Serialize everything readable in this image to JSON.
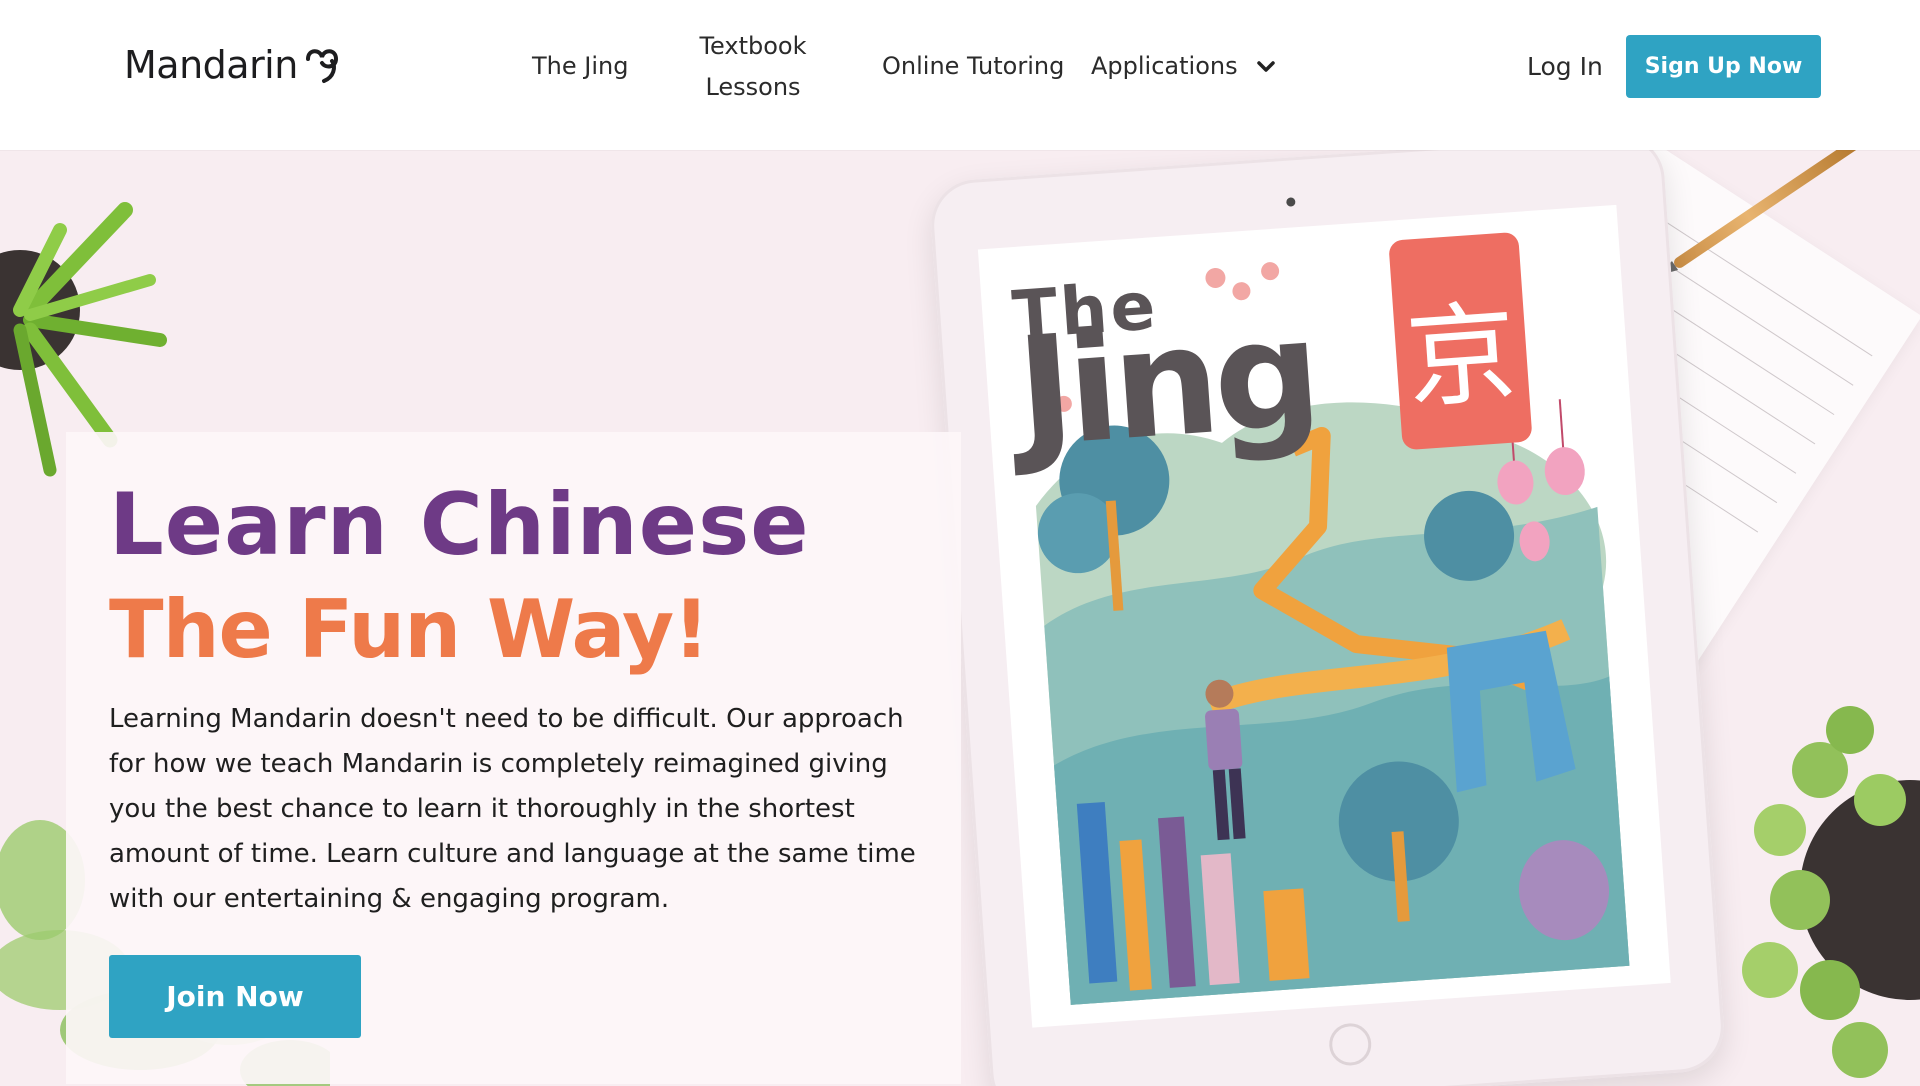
{
  "header": {
    "logo_text": "Mandarin",
    "nav": {
      "the_jing": "The Jing",
      "textbook_line1": "Textbook",
      "textbook_line2": "Lessons",
      "online_tutoring": "Online Tutoring",
      "applications": "Applications"
    },
    "login_label": "Log In",
    "signup_label": "Sign Up Now"
  },
  "hero": {
    "headline": "Learn Chinese",
    "subheadline": "The Fun Way!",
    "description": "Learning Mandarin doesn't need to be difficult. Our approach for how we teach Mandarin is completely reimagined giving you the best chance to learn it thoroughly in the shortest amount of time. Learn culture and language at the same time with our entertaining & engaging program.",
    "cta_label": "Join Now"
  },
  "tablet_cover": {
    "title_small": "The",
    "title_large": "Jing",
    "seal_glyph": "京"
  },
  "colors": {
    "accent_blue": "#2fa3c3",
    "headline_purple": "#6e3a86",
    "subheadline_orange": "#ee7a4a",
    "hero_background": "#f8edf1"
  },
  "icons": {
    "applications_dropdown": "chevron-down-icon",
    "logo_mark": "heart-swirl-icon"
  }
}
